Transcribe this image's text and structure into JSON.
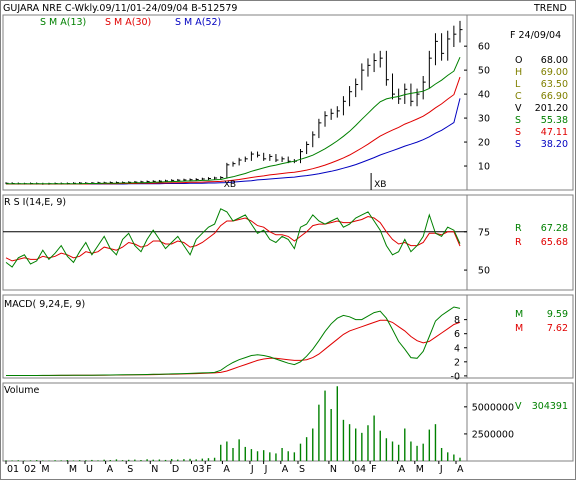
{
  "header": {
    "title": "GUJARA NRE C-Wkly.09/11/01-24/09/04  B-512579",
    "mode": "TREND",
    "date": "F 24/09/04"
  },
  "colors": {
    "price": "#000000",
    "sma13": "#008000",
    "sma30": "#e00000",
    "sma52": "#0000c0",
    "value_olive": "#808000",
    "value_black": "#000000",
    "border": "#808080"
  },
  "chart_data": [
    {
      "type": "line",
      "panel": "price",
      "legend": [
        {
          "label": "S M A(13)",
          "color": "#008000"
        },
        {
          "label": "S M A(30)",
          "color": "#e00000"
        },
        {
          "label": "S M A(52)",
          "color": "#0000c0"
        }
      ],
      "yticks": [
        10,
        20,
        30,
        40,
        50,
        60
      ],
      "ylim": [
        0,
        73
      ],
      "readout": [
        {
          "k": "O",
          "v": "68.00",
          "color": "#000000"
        },
        {
          "k": "H",
          "v": "69.00",
          "color": "#808000"
        },
        {
          "k": "L",
          "v": "63.50",
          "color": "#808000"
        },
        {
          "k": "C",
          "v": "66.90",
          "color": "#808000"
        },
        {
          "k": "V",
          "v": "201.20",
          "color": "#000000"
        },
        {
          "k": "S",
          "v": "55.38",
          "color": "#008000"
        },
        {
          "k": "S",
          "v": "47.11",
          "color": "#e00000"
        },
        {
          "k": "S",
          "v": "38.20",
          "color": "#0000c0"
        }
      ],
      "annotations": [
        {
          "text": "XB",
          "week": 35,
          "value": 3
        },
        {
          "text": "XB",
          "week": 63,
          "value": 3
        }
      ],
      "close": [
        2.8,
        2.7,
        2.6,
        2.6,
        2.7,
        2.6,
        2.5,
        2.6,
        2.7,
        2.6,
        2.7,
        2.8,
        2.9,
        2.8,
        2.9,
        3.0,
        3.0,
        3.1,
        3.1,
        3.1,
        3.2,
        3.3,
        3.4,
        3.5,
        3.6,
        3.7,
        3.8,
        4.0,
        4.1,
        4.2,
        4.3,
        4.4,
        4.6,
        4.8,
        5.0,
        5.2,
        10.5,
        11.0,
        12.5,
        13.0,
        15.0,
        14.5,
        13.0,
        14.0,
        12.5,
        13.0,
        12.0,
        12.0,
        16.0,
        19.0,
        23.0,
        28.0,
        31.0,
        32.0,
        33.0,
        37.0,
        41.0,
        44.0,
        50.0,
        52.0,
        54.0,
        55.0,
        46.0,
        40.0,
        38.0,
        42.0,
        37.0,
        40.0,
        45.0,
        55.0,
        62.0,
        57.0,
        63.0,
        65.0,
        66.9
      ],
      "sma13": [
        2.6,
        2.6,
        2.6,
        2.6,
        2.6,
        2.6,
        2.6,
        2.6,
        2.6,
        2.6,
        2.6,
        2.6,
        2.6,
        2.7,
        2.7,
        2.7,
        2.8,
        2.8,
        2.8,
        2.9,
        2.9,
        3.0,
        3.0,
        3.1,
        3.2,
        3.3,
        3.4,
        3.5,
        3.6,
        3.7,
        3.8,
        3.9,
        4.0,
        4.1,
        4.3,
        4.4,
        5.0,
        5.5,
        6.2,
        6.9,
        7.8,
        8.5,
        9.2,
        9.9,
        10.4,
        11.0,
        11.5,
        12.0,
        12.8,
        13.6,
        14.5,
        15.8,
        17.2,
        18.8,
        20.5,
        22.4,
        24.5,
        26.9,
        29.5,
        32.0,
        34.5,
        36.8,
        38.0,
        38.6,
        39.0,
        39.8,
        40.3,
        40.7,
        41.2,
        42.4,
        44.2,
        45.8,
        47.8,
        49.6,
        55.38
      ],
      "sma30": [
        2.5,
        2.5,
        2.5,
        2.5,
        2.5,
        2.5,
        2.5,
        2.5,
        2.5,
        2.5,
        2.5,
        2.5,
        2.5,
        2.5,
        2.6,
        2.6,
        2.6,
        2.6,
        2.6,
        2.7,
        2.7,
        2.7,
        2.8,
        2.8,
        2.8,
        2.9,
        2.9,
        3.0,
        3.0,
        3.1,
        3.2,
        3.2,
        3.3,
        3.4,
        3.5,
        3.6,
        3.8,
        4.1,
        4.4,
        4.8,
        5.2,
        5.6,
        5.9,
        6.3,
        6.6,
        6.9,
        7.2,
        7.4,
        7.8,
        8.3,
        8.9,
        9.6,
        10.4,
        11.3,
        12.3,
        13.4,
        14.6,
        16.0,
        17.5,
        19.1,
        20.8,
        22.5,
        23.8,
        25.0,
        26.1,
        27.5,
        28.5,
        29.6,
        30.8,
        32.4,
        34.3,
        35.9,
        37.9,
        39.8,
        47.11
      ],
      "sma52": [
        2.5,
        2.5,
        2.5,
        2.5,
        2.5,
        2.5,
        2.5,
        2.5,
        2.5,
        2.5,
        2.5,
        2.5,
        2.5,
        2.5,
        2.5,
        2.5,
        2.5,
        2.5,
        2.5,
        2.5,
        2.6,
        2.6,
        2.6,
        2.6,
        2.6,
        2.6,
        2.7,
        2.7,
        2.7,
        2.7,
        2.8,
        2.8,
        2.8,
        2.9,
        2.9,
        3.0,
        3.1,
        3.3,
        3.5,
        3.7,
        3.9,
        4.2,
        4.4,
        4.6,
        4.8,
        5.0,
        5.2,
        5.4,
        5.7,
        6.0,
        6.4,
        6.8,
        7.3,
        7.8,
        8.4,
        9.1,
        9.8,
        10.6,
        11.5,
        12.5,
        13.5,
        14.6,
        15.5,
        16.4,
        17.3,
        18.3,
        19.1,
        20.0,
        21.0,
        22.2,
        23.7,
        24.9,
        26.5,
        28.1,
        38.2
      ]
    },
    {
      "type": "line",
      "panel": "rsi",
      "title": "R S I(14,E, 9)",
      "yticks": [
        50,
        75
      ],
      "ylim": [
        37,
        99
      ],
      "reference_line": 75,
      "readout": [
        {
          "k": "R",
          "v": "67.28",
          "color": "#008000"
        },
        {
          "k": "R",
          "v": "65.68",
          "color": "#e00000"
        }
      ],
      "rsi": [
        55,
        52,
        58,
        60,
        54,
        56,
        63,
        57,
        61,
        66,
        59,
        55,
        62,
        68,
        60,
        66,
        72,
        64,
        60,
        70,
        74,
        66,
        62,
        70,
        76,
        70,
        64,
        68,
        72,
        66,
        60,
        70,
        74,
        78,
        80,
        90,
        88,
        82,
        84,
        86,
        80,
        74,
        76,
        70,
        68,
        72,
        70,
        64,
        78,
        80,
        86,
        82,
        80,
        82,
        84,
        78,
        80,
        84,
        86,
        88,
        82,
        76,
        66,
        60,
        62,
        70,
        62,
        66,
        72,
        86,
        74,
        72,
        78,
        76,
        67.28
      ],
      "signal": [
        58,
        56,
        57,
        58,
        57,
        57,
        59,
        58,
        59,
        61,
        60,
        58,
        59,
        62,
        61,
        62,
        65,
        64,
        63,
        65,
        68,
        67,
        65,
        66,
        69,
        69,
        67,
        67,
        69,
        68,
        65,
        66,
        68,
        71,
        74,
        79,
        82,
        82,
        83,
        84,
        82,
        79,
        78,
        75,
        73,
        73,
        72,
        69,
        72,
        75,
        79,
        80,
        80,
        81,
        82,
        81,
        81,
        82,
        83,
        85,
        84,
        81,
        75,
        70,
        67,
        68,
        66,
        66,
        68,
        74,
        74,
        73,
        75,
        75,
        65.68
      ]
    },
    {
      "type": "line",
      "panel": "macd",
      "title": "MACD( 9,24,E, 9)",
      "yticks": [
        0,
        2,
        4,
        6,
        8
      ],
      "ylim": [
        -0.3,
        11.5
      ],
      "readout": [
        {
          "k": "M",
          "v": "9.59",
          "color": "#008000"
        },
        {
          "k": "M",
          "v": "7.62",
          "color": "#e00000"
        }
      ],
      "macd": [
        0.05,
        0.05,
        0.05,
        0.06,
        0.06,
        0.06,
        0.07,
        0.07,
        0.07,
        0.08,
        0.08,
        0.09,
        0.09,
        0.1,
        0.1,
        0.11,
        0.12,
        0.13,
        0.14,
        0.15,
        0.16,
        0.17,
        0.18,
        0.2,
        0.22,
        0.24,
        0.26,
        0.28,
        0.3,
        0.33,
        0.36,
        0.39,
        0.42,
        0.46,
        0.5,
        0.8,
        1.4,
        1.9,
        2.3,
        2.6,
        2.9,
        3.0,
        2.9,
        2.7,
        2.4,
        2.1,
        1.8,
        1.6,
        2.0,
        2.8,
        3.8,
        5.0,
        6.3,
        7.4,
        8.2,
        8.6,
        8.4,
        8.0,
        8.0,
        8.5,
        9.0,
        9.2,
        8.2,
        6.6,
        4.9,
        3.8,
        2.6,
        2.5,
        3.5,
        5.6,
        7.8,
        8.6,
        9.2,
        9.8,
        9.59
      ],
      "signal": [
        0.05,
        0.05,
        0.05,
        0.05,
        0.05,
        0.06,
        0.06,
        0.06,
        0.07,
        0.07,
        0.07,
        0.08,
        0.08,
        0.09,
        0.09,
        0.1,
        0.1,
        0.11,
        0.12,
        0.13,
        0.14,
        0.15,
        0.16,
        0.17,
        0.19,
        0.2,
        0.22,
        0.24,
        0.26,
        0.28,
        0.31,
        0.33,
        0.36,
        0.39,
        0.42,
        0.5,
        0.7,
        1.0,
        1.3,
        1.6,
        1.9,
        2.2,
        2.4,
        2.5,
        2.5,
        2.4,
        2.3,
        2.2,
        2.2,
        2.3,
        2.6,
        3.1,
        3.8,
        4.5,
        5.2,
        5.9,
        6.4,
        6.7,
        7.0,
        7.3,
        7.6,
        7.9,
        7.9,
        7.6,
        7.0,
        6.4,
        5.6,
        5.0,
        4.7,
        4.9,
        5.5,
        6.1,
        6.7,
        7.3,
        7.62
      ]
    },
    {
      "type": "bar",
      "panel": "volume",
      "title": "Volume",
      "yticks": [
        2500000,
        5000000
      ],
      "ytick_labels": [
        "2500000",
        "5000000"
      ],
      "ylim": [
        0,
        7200000
      ],
      "readout": [
        {
          "k": "V",
          "v": "304391",
          "color": "#008000"
        }
      ],
      "volume": [
        60000,
        50000,
        70000,
        40000,
        60000,
        80000,
        50000,
        40000,
        70000,
        60000,
        90000,
        50000,
        80000,
        70000,
        100000,
        60000,
        120000,
        90000,
        150000,
        80000,
        110000,
        130000,
        90000,
        160000,
        120000,
        140000,
        100000,
        180000,
        130000,
        170000,
        200000,
        150000,
        220000,
        260000,
        300000,
        1500000,
        1800000,
        1200000,
        2000000,
        1300000,
        1100000,
        900000,
        1000000,
        800000,
        700000,
        1200000,
        900000,
        800000,
        1600000,
        2200000,
        3000000,
        5200000,
        6500000,
        4800000,
        6900000,
        3800000,
        3400000,
        3000000,
        2600000,
        3300000,
        4200000,
        2800000,
        2100000,
        1800000,
        1500000,
        3000000,
        1800000,
        1400000,
        1600000,
        2900000,
        3400000,
        1200000,
        800000,
        600000,
        304391
      ]
    }
  ],
  "xaxis": {
    "labels": [
      "01",
      "02",
      "M",
      "M",
      "U",
      "A",
      "S",
      "N",
      "D",
      "03",
      "F",
      "A",
      "J",
      "J",
      "A",
      "S",
      "N",
      "04",
      "F",
      "A",
      "M",
      "J",
      "A"
    ],
    "weeks": [
      0,
      5,
      10,
      18,
      23,
      29,
      35,
      42,
      48,
      54,
      58,
      63,
      71,
      75,
      80,
      85,
      94,
      101,
      106,
      114,
      119,
      126,
      131
    ]
  }
}
